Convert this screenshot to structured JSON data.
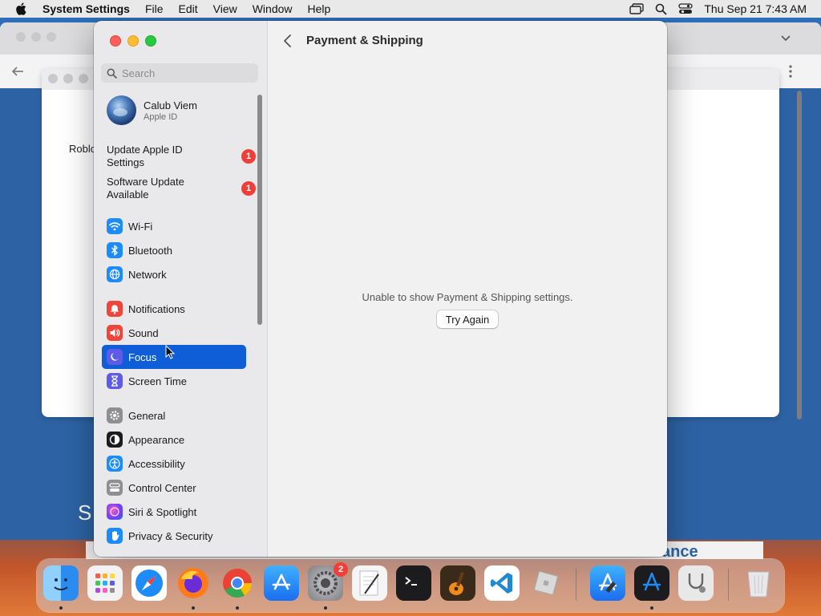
{
  "menubar": {
    "app_name": "System Settings",
    "items": [
      "File",
      "Edit",
      "View",
      "Window",
      "Help"
    ],
    "clock": "Thu Sep 21  7:43 AM"
  },
  "background": {
    "left_text": "Roblo",
    "bottom_left_text": "S",
    "bottom_strip_text": "ance"
  },
  "sidebar": {
    "search_placeholder": "Search",
    "profile": {
      "name": "Calub Viem",
      "subtitle": "Apple ID"
    },
    "alerts": [
      {
        "label": "Update Apple ID Settings",
        "badge": "1"
      },
      {
        "label": "Software Update Available",
        "badge": "1"
      }
    ],
    "items": [
      {
        "label": "Wi-Fi",
        "icon": "wifi-icon",
        "color": "#1d8cf8"
      },
      {
        "label": "Bluetooth",
        "icon": "bluetooth-icon",
        "color": "#1d8cf8"
      },
      {
        "label": "Network",
        "icon": "globe-icon",
        "color": "#1d8cf8"
      },
      {
        "label": "Notifications",
        "icon": "bell-icon",
        "color": "#f0453a"
      },
      {
        "label": "Sound",
        "icon": "speaker-icon",
        "color": "#f0453a"
      },
      {
        "label": "Focus",
        "icon": "moon-icon",
        "color": "#5e5ce6",
        "selected": true
      },
      {
        "label": "Screen Time",
        "icon": "hourglass-icon",
        "color": "#5e5ce6"
      },
      {
        "label": "General",
        "icon": "gear-icon",
        "color": "#8e8e93"
      },
      {
        "label": "Appearance",
        "icon": "appearance-icon",
        "color": "#1c1c1e"
      },
      {
        "label": "Accessibility",
        "icon": "accessibility-icon",
        "color": "#1d8cf8"
      },
      {
        "label": "Control Center",
        "icon": "control-center-icon",
        "color": "#8e8e93"
      },
      {
        "label": "Siri & Spotlight",
        "icon": "siri-icon",
        "color": "#b44be0"
      },
      {
        "label": "Privacy & Security",
        "icon": "hand-icon",
        "color": "#1d8cf8"
      }
    ]
  },
  "pane": {
    "title": "Payment & Shipping",
    "message": "Unable to show Payment & Shipping settings.",
    "retry_label": "Try Again"
  },
  "dock": {
    "apps": [
      {
        "name": "finder-icon",
        "color": "#2a8cf0"
      },
      {
        "name": "launchpad-icon",
        "color": "#f2f2f2"
      },
      {
        "name": "safari-icon",
        "color": "#1d8cf8"
      },
      {
        "name": "firefox-icon",
        "color": "#ff6b1a"
      },
      {
        "name": "chrome-icon",
        "color": "#ffffff"
      },
      {
        "name": "app-store-icon",
        "color": "#1d8cf8"
      },
      {
        "name": "system-settings-icon",
        "color": "#8e8e93",
        "badge": "2"
      },
      {
        "name": "textedit-icon",
        "color": "#f5f5f5"
      },
      {
        "name": "terminal-icon",
        "color": "#1c1c1e"
      },
      {
        "name": "garageband-icon",
        "color": "#f08a1a"
      },
      {
        "name": "vscode-icon",
        "color": "#ffffff"
      },
      {
        "name": "roblox-icon",
        "color": "#d9d9d9"
      },
      {
        "name": "xcode-icon",
        "color": "#1d8cf8"
      },
      {
        "name": "instruments-icon",
        "color": "#1c1c1e"
      },
      {
        "name": "disk-utility-icon",
        "color": "#e8e8e8"
      },
      {
        "name": "trash-icon",
        "color": "#e5e5e5"
      }
    ]
  }
}
